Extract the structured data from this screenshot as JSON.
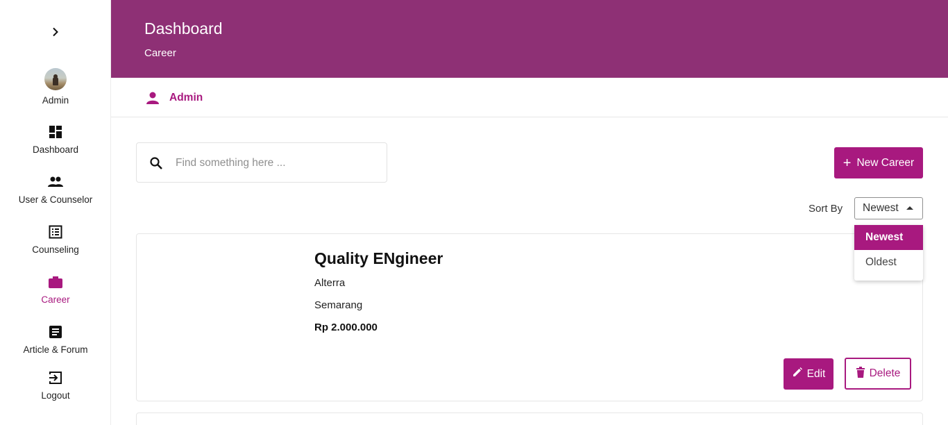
{
  "sidebar": {
    "items": [
      {
        "label": "Admin",
        "icon": "avatar"
      },
      {
        "label": "Dashboard",
        "icon": "dashboard-icon"
      },
      {
        "label": "User & Counselor",
        "icon": "people-icon"
      },
      {
        "label": "Counseling",
        "icon": "list-icon"
      },
      {
        "label": "Career",
        "icon": "briefcase-icon",
        "active": true
      },
      {
        "label": "Article & Forum",
        "icon": "article-icon"
      },
      {
        "label": "Logout",
        "icon": "logout-icon"
      }
    ]
  },
  "header": {
    "title": "Dashboard",
    "subtitle": "Career"
  },
  "userbar": {
    "name": "Admin"
  },
  "search": {
    "placeholder": "Find something here ..."
  },
  "new_button": {
    "label": "New Career"
  },
  "sort": {
    "label": "Sort By",
    "selected": "Newest",
    "options": [
      "Newest",
      "Oldest"
    ]
  },
  "careers": [
    {
      "title": "Quality ENgineer",
      "company": "Alterra",
      "location": "Semarang",
      "salary": "Rp 2.000.000",
      "edit_label": "Edit",
      "delete_label": "Delete"
    }
  ],
  "colors": {
    "header": "#8e3075",
    "accent": "#a8197f"
  }
}
